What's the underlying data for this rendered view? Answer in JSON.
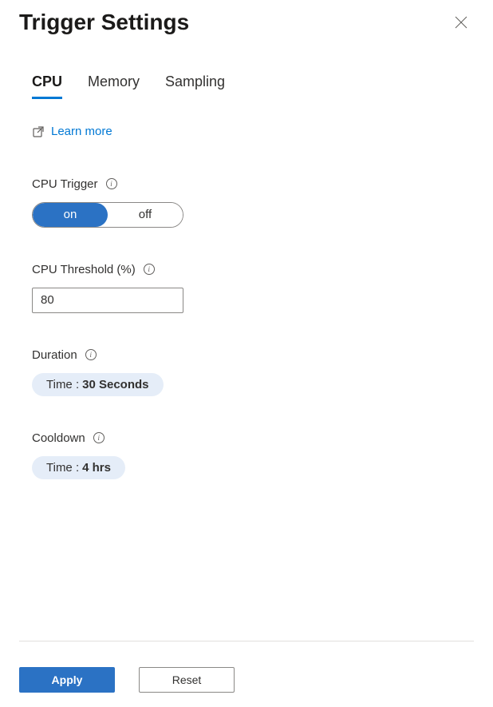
{
  "header": {
    "title": "Trigger Settings"
  },
  "tabs": {
    "items": [
      {
        "label": "CPU",
        "active": true
      },
      {
        "label": "Memory",
        "active": false
      },
      {
        "label": "Sampling",
        "active": false
      }
    ]
  },
  "learn_more": {
    "label": "Learn more"
  },
  "cpu_trigger": {
    "label": "CPU Trigger",
    "options": {
      "on": "on",
      "off": "off"
    },
    "value": "on"
  },
  "cpu_threshold": {
    "label": "CPU Threshold (%)",
    "value": "80"
  },
  "duration": {
    "label": "Duration",
    "prefix": "Time : ",
    "value": "30 Seconds"
  },
  "cooldown": {
    "label": "Cooldown",
    "prefix": "Time : ",
    "value": "4 hrs"
  },
  "footer": {
    "apply": "Apply",
    "reset": "Reset"
  }
}
